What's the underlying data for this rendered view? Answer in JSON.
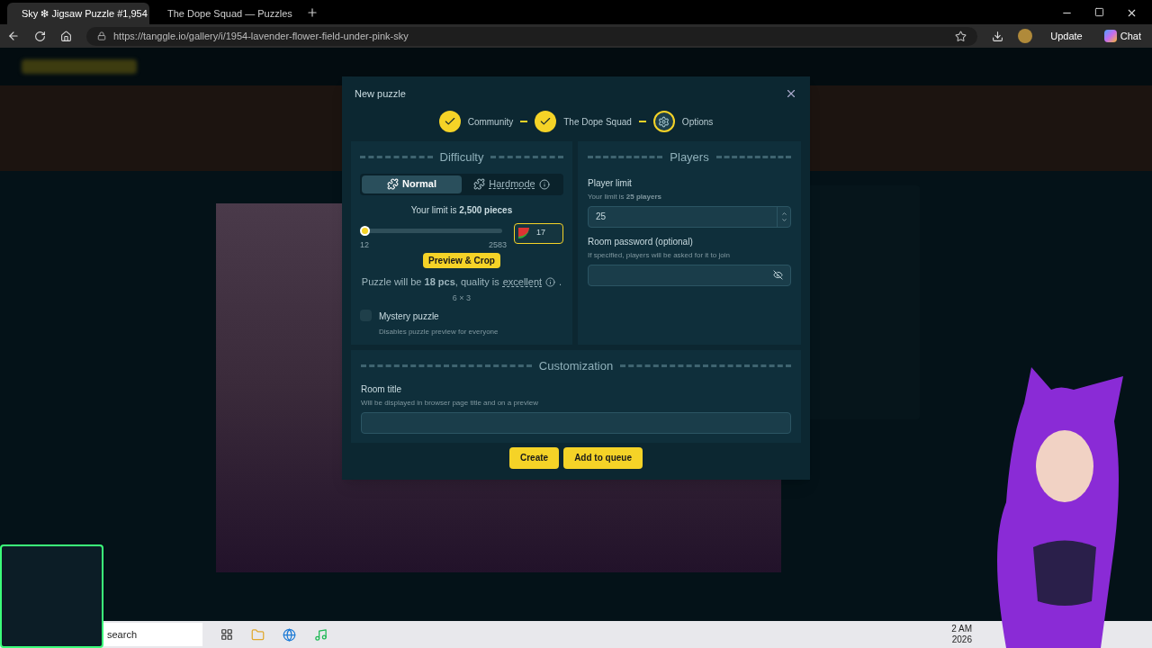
{
  "browser": {
    "tabs": [
      {
        "title": "Sky ❇ Jigsaw Puzzle #1,954",
        "selected": true
      },
      {
        "title": "The Dope Squad — Puzzles",
        "selected": false
      }
    ],
    "url": "https://tanggle.io/gallery/i/1954-lavender-flower-field-under-pink-sky",
    "update": "Update",
    "chat": "Chat"
  },
  "modal": {
    "title": "New puzzle",
    "steps": [
      {
        "label": "Community",
        "kind": "done"
      },
      {
        "label": "The Dope Squad",
        "kind": "done"
      },
      {
        "label": "Options",
        "kind": "current"
      }
    ],
    "difficulty": {
      "heading": "Difficulty",
      "modes": [
        {
          "label": "Normal",
          "selected": true,
          "info": false
        },
        {
          "label": "Hardmode",
          "selected": false,
          "info": true
        }
      ],
      "limit": "Your limit is **2,500 pieces**",
      "slider": {
        "min": "12",
        "max": "2583",
        "level": 0.002
      },
      "pieces": "17",
      "preview_button": "Preview & Crop",
      "summary": "Puzzle will be **18 pcs**, quality is",
      "quality": "excellent",
      "summary_end": ".",
      "grid": "6 × 3",
      "mystery": {
        "label": "Mystery puzzle",
        "hint": "Disables puzzle preview for everyone",
        "checked": false
      }
    },
    "players": {
      "heading": "Players",
      "limit": {
        "label": "Player limit",
        "hint": "Your limit is **25 players**",
        "value": "25"
      },
      "password": {
        "label": "Room password (optional)",
        "hint": "If specified, players will be asked for it to join"
      }
    },
    "customization": {
      "heading": "Customization",
      "room_title": {
        "label": "Room title",
        "hint": "Will be displayed in browser page title and on a preview"
      }
    },
    "buttons": [
      "Create",
      "Add to queue"
    ]
  },
  "taskbar": {
    "search": "search",
    "time": "2 AM",
    "date": "2026"
  }
}
